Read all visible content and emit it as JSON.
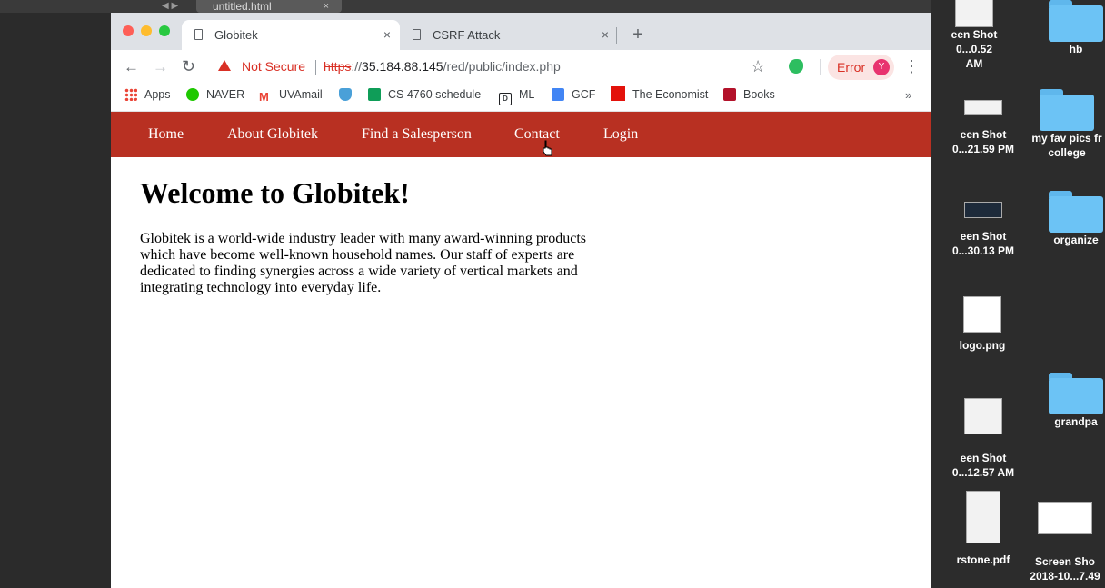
{
  "background_window": {
    "tab_title": "untitled.html",
    "tab_close": "×",
    "nav_arrows": "◀ ▶",
    "dropdown": "▼"
  },
  "desktop": {
    "items": [
      {
        "label_line1": "een Shot",
        "label_line2": "0...0.52 AM",
        "kind": "screenshot"
      },
      {
        "label_line1": "hb",
        "label_line2": "",
        "kind": "folder"
      },
      {
        "label_line1": "een Shot",
        "label_line2": "0...21.59 PM",
        "kind": "screenshot"
      },
      {
        "label_line1": "my fav pics fr",
        "label_line2": "college",
        "kind": "folder"
      },
      {
        "label_line1": "een Shot",
        "label_line2": "0...30.13 PM",
        "kind": "screenshot"
      },
      {
        "label_line1": "organize",
        "label_line2": "",
        "kind": "folder"
      },
      {
        "label_line1": "logo.png",
        "label_line2": "",
        "kind": "image"
      },
      {
        "label_line1": "grandpa",
        "label_line2": "",
        "kind": "folder"
      },
      {
        "label_line1": "een Shot",
        "label_line2": "0...12.57 AM",
        "kind": "screenshot"
      },
      {
        "label_line1": "rstone.pdf",
        "label_line2": "",
        "kind": "pdf"
      },
      {
        "label_line1": "Screen Sho",
        "label_line2": "2018-10...7.49",
        "kind": "screenshot"
      }
    ]
  },
  "browser": {
    "tabs": [
      {
        "title": "Globitek",
        "close": "×",
        "active": true
      },
      {
        "title": "CSRF Attack",
        "close": "×",
        "active": false
      }
    ],
    "new_tab": "+",
    "toolbar": {
      "back": "←",
      "forward": "→",
      "reload": "↻",
      "security_label": "Not Secure",
      "url_scheme": "https",
      "url_sep": "://",
      "url_host": "35.184.88.145",
      "url_path": "/red/public/index.php",
      "star": "☆",
      "error_label": "Error",
      "avatar_letter": "Y",
      "menu": "⋮"
    },
    "bookmarks": [
      {
        "label": "Apps",
        "icon": "apps-grid-icon"
      },
      {
        "label": "NAVER",
        "icon": "naver-icon"
      },
      {
        "label": "UVAmail",
        "icon": "gmail-icon"
      },
      {
        "label": "",
        "icon": "shield-icon"
      },
      {
        "label": "CS 4760 schedule",
        "icon": "sheets-icon"
      },
      {
        "label": "ML",
        "icon": "ml-icon"
      },
      {
        "label": "GCF",
        "icon": "docs-icon"
      },
      {
        "label": "The Economist",
        "icon": "economist-icon"
      },
      {
        "label": "Books",
        "icon": "books-icon"
      }
    ],
    "bookmarks_more": "»"
  },
  "site": {
    "nav": [
      "Home",
      "About Globitek",
      "Find a Salesperson",
      "Contact",
      "Login"
    ],
    "heading": "Welcome to Globitek!",
    "body": "Globitek is a world-wide industry leader with many award-winning products which have become well-known household names. Our staff of experts are dedicated to finding synergies across a wide variety of vertical markets and integrating technology into everyday life.",
    "nav_color": "#b83022"
  }
}
